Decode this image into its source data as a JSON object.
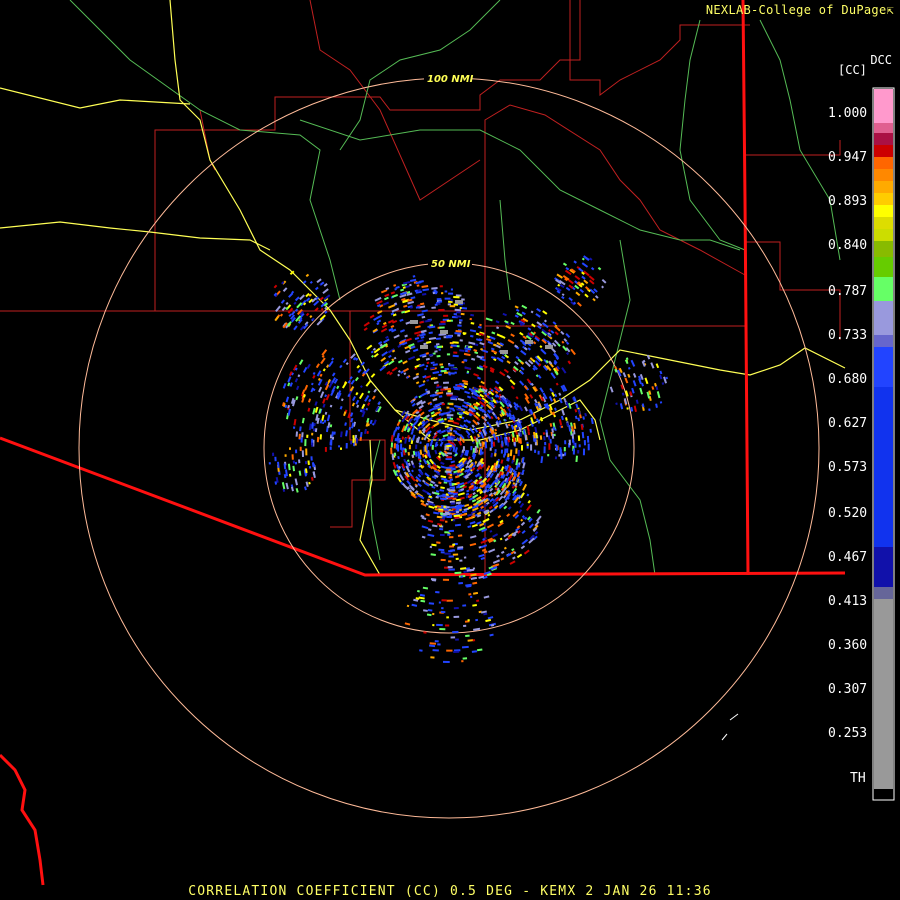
{
  "header": {
    "credit": "NEXLAB-College of DuPage"
  },
  "range_rings": [
    {
      "label": "50 NMI"
    },
    {
      "label": "100 NMI"
    }
  ],
  "legend": {
    "product": "DCC",
    "unit": "[CC]",
    "ticks": [
      "1.000",
      "0.947",
      "0.893",
      "0.840",
      "0.787",
      "0.733",
      "0.680",
      "0.627",
      "0.573",
      "0.520",
      "0.467",
      "0.413",
      "0.360",
      "0.307",
      "0.253",
      "TH"
    ],
    "colors": {
      "top": "#ff99cc",
      "pink": "#e06090",
      "red": "#cc0000",
      "orange": "#ff6600",
      "amber": "#ffaa00",
      "yellow": "#ffff00",
      "yellow_green": "#ccdd00",
      "green": "#66cc00",
      "light_green": "#66ff66",
      "lavender": "#9999dd",
      "blue": "#2244ff",
      "navy": "#1111aa",
      "gray": "#999999",
      "black": "#000000"
    }
  },
  "colors": {
    "background": "#000000",
    "state_border": "#ff0000",
    "county_border": "#cc2222",
    "highway": "#ffff66",
    "river": "#66cc66",
    "range_ring": "#ffcc99"
  },
  "footer": {
    "caption": "CORRELATION COEFFICIENT (CC) 0.5 DEG - KEMX 2 JAN 26 11:36"
  }
}
